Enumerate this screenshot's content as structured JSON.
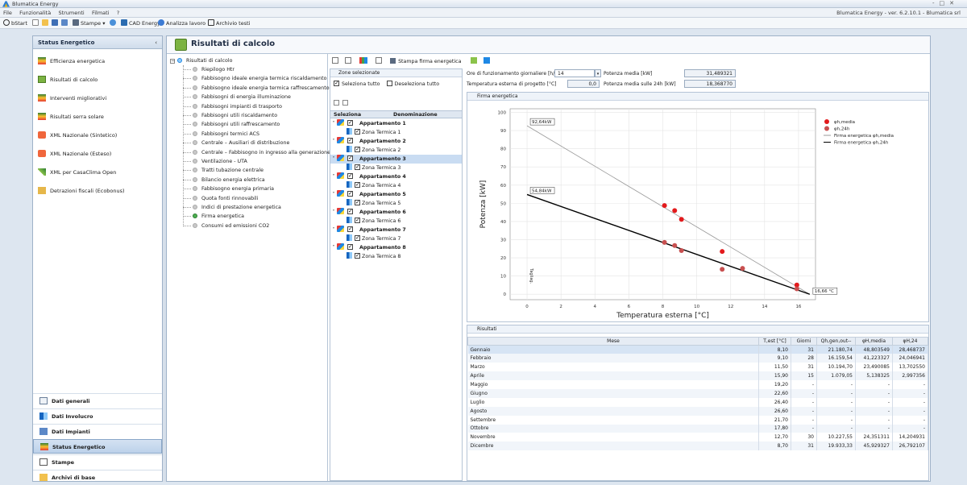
{
  "window": {
    "title": "Blumatica Energy",
    "controls": [
      "-",
      "□",
      "✕"
    ]
  },
  "menubar": {
    "items": [
      "File",
      "Funzionalità",
      "Strumenti",
      "Filmati",
      "?"
    ],
    "version": "Blumatica Energy - ver. 6.2.10.1 - Blumatica srl"
  },
  "toolbar": {
    "start": "bStart",
    "print": "Stampe",
    "cad": "CAD Energy",
    "analyze": "Analizza lavoro",
    "archive": "Archivio testi"
  },
  "sidebar": {
    "header": "Status Energetico",
    "collapse": "‹",
    "items": [
      {
        "label": "Efficienza energetica"
      },
      {
        "label": "Risultati di calcolo"
      },
      {
        "label": "Interventi migliorativi"
      },
      {
        "label": "Risultati serra solare"
      },
      {
        "label": "XML Nazionale (Sintetico)"
      },
      {
        "label": "XML Nazionale (Esteso)"
      },
      {
        "label": "XML per CasaClima Open"
      },
      {
        "label": "Detrazioni fiscali (Ecobonus)"
      }
    ],
    "nav": [
      {
        "label": "Dati generali"
      },
      {
        "label": "Dati Involucro"
      },
      {
        "label": "Dati Impianti"
      },
      {
        "label": "Status Energetico"
      },
      {
        "label": "Stampe"
      },
      {
        "label": "Archivi di base"
      }
    ]
  },
  "main": {
    "title": "Risultati di calcolo",
    "tree": {
      "root": "Risultati di calcolo",
      "items": [
        "Riepilogo Htr",
        "Fabbisogno ideale energia termica riscaldamento",
        "Fabbisogno ideale energia termica raffrescamento",
        "Fabbisogni di energia illuminazione",
        "Fabbisogni impianti di trasporto",
        "Fabbisogni utili riscaldamento",
        "Fabbisogni utili raffrescamento",
        "Fabbisogni termici ACS",
        "Centrale – Ausiliari di distribuzione",
        "Centrale – Fabbisogno in ingresso alla generazione",
        "Ventilazione - UTA",
        "Tratti tubazione centrale",
        "Bilancio energia elettrica",
        "Fabbisogno energia primaria",
        "Quota fonti rinnovabili",
        "Indici di prestazione energetica",
        "Firma energetica",
        "Consumi ed emissioni CO2"
      ]
    },
    "print_signature": "Stampa firma energetica",
    "zones": {
      "header": "Zone selezionate",
      "select_all": "Seleziona tutto",
      "deselect_all": "Deseleziona tutto",
      "col_select": "Seleziona",
      "col_name": "Denominazione",
      "rows": [
        {
          "name": "Appartamento 1",
          "type": "app"
        },
        {
          "name": "Zona Termica 1",
          "type": "zone"
        },
        {
          "name": "Appartamento 2",
          "type": "app"
        },
        {
          "name": "Zona Termica 2",
          "type": "zone"
        },
        {
          "name": "Appartamento 3",
          "type": "app"
        },
        {
          "name": "Zona Termica 3",
          "type": "zone"
        },
        {
          "name": "Appartamento 4",
          "type": "app"
        },
        {
          "name": "Zona Termica 4",
          "type": "zone"
        },
        {
          "name": "Appartamento 5",
          "type": "app"
        },
        {
          "name": "Zona Termica 5",
          "type": "zone"
        },
        {
          "name": "Appartamento 6",
          "type": "app"
        },
        {
          "name": "Zona Termica 6",
          "type": "zone"
        },
        {
          "name": "Appartamento 7",
          "type": "app"
        },
        {
          "name": "Zona Termica 7",
          "type": "zone"
        },
        {
          "name": "Appartamento 8",
          "type": "app"
        },
        {
          "name": "Zona Termica 8",
          "type": "zone"
        }
      ]
    },
    "params": {
      "hours_label": "Ore di funzionamento giornaliere [h/g]",
      "hours_value": "14",
      "avg_power_label": "Potenza media [kW]",
      "avg_power_value": "31,489321",
      "ext_temp_label": "Temperatura esterna di progetto [°C]",
      "ext_temp_value": "0,0",
      "avg_power24_label": "Potenza media sulle 24h [kW]",
      "avg_power24_value": "18,368770"
    },
    "chart_header": "Firma energetica",
    "results_header": "Risultati"
  },
  "chart_data": {
    "type": "scatter",
    "xlabel": "Temperatura esterna [°C]",
    "ylabel": "Potenza [kW]",
    "xlim": [
      -1,
      17
    ],
    "ylim": [
      -3,
      102
    ],
    "xticks": [
      0,
      2,
      4,
      6,
      8,
      10,
      12,
      14,
      16
    ],
    "yticks": [
      0,
      10,
      20,
      30,
      40,
      50,
      60,
      70,
      80,
      90,
      100
    ],
    "grid": true,
    "legend": "top-right",
    "inner_label": "Tagliag.",
    "annotations": [
      {
        "text": "92,64kW",
        "x": 0,
        "y": 92.64
      },
      {
        "text": "54,84kW",
        "x": 0,
        "y": 54.84
      },
      {
        "text": "16,66 °C",
        "x": 16.66,
        "y": 0
      }
    ],
    "series": [
      {
        "name": "φh,media",
        "kind": "points",
        "color": "#e31a1c",
        "x": [
          8.1,
          8.7,
          9.1,
          11.5,
          15.9
        ],
        "y": [
          48.8,
          46.0,
          41.2,
          23.5,
          5.1
        ]
      },
      {
        "name": "φh,24h",
        "kind": "points",
        "color": "#c85050",
        "x": [
          8.1,
          8.7,
          9.1,
          11.5,
          12.7,
          15.9
        ],
        "y": [
          28.5,
          26.8,
          24.0,
          13.7,
          14.2,
          3.0
        ]
      },
      {
        "name": "Firma energetica φh,media",
        "kind": "line",
        "color": "#999999",
        "x": [
          0,
          16.66
        ],
        "y": [
          92.64,
          0
        ]
      },
      {
        "name": "Firma energetica φh,24h",
        "kind": "line",
        "color": "#000000",
        "x": [
          0,
          16.66
        ],
        "y": [
          54.84,
          0
        ]
      }
    ]
  },
  "results_table": {
    "columns": [
      "Mese",
      "T,est [°C]",
      "Giorni",
      "Qh,gen,out--",
      "φH,media",
      "φH,24"
    ],
    "rows": [
      [
        "Gennaio",
        "8,10",
        "31",
        "21.180,74",
        "48,803549",
        "28,468737"
      ],
      [
        "Febbraio",
        "9,10",
        "28",
        "16.159,54",
        "41,223327",
        "24,046941"
      ],
      [
        "Marzo",
        "11,50",
        "31",
        "10.194,70",
        "23,490085",
        "13,702550"
      ],
      [
        "Aprile",
        "15,90",
        "15",
        "1.079,05",
        "5,138325",
        "2,997356"
      ],
      [
        "Maggio",
        "19,20",
        "-",
        "-",
        "-",
        "-"
      ],
      [
        "Giugno",
        "22,60",
        "-",
        "-",
        "-",
        "-"
      ],
      [
        "Luglio",
        "26,40",
        "-",
        "-",
        "-",
        "-"
      ],
      [
        "Agosto",
        "26,60",
        "-",
        "-",
        "-",
        "-"
      ],
      [
        "Settembre",
        "21,70",
        "-",
        "-",
        "-",
        "-"
      ],
      [
        "Ottobre",
        "17,80",
        "-",
        "-",
        "-",
        "-"
      ],
      [
        "Novembre",
        "12,70",
        "30",
        "10.227,55",
        "24,351311",
        "14,204931"
      ],
      [
        "Dicembre",
        "8,70",
        "31",
        "19.933,33",
        "45,929327",
        "26,792107"
      ]
    ]
  }
}
